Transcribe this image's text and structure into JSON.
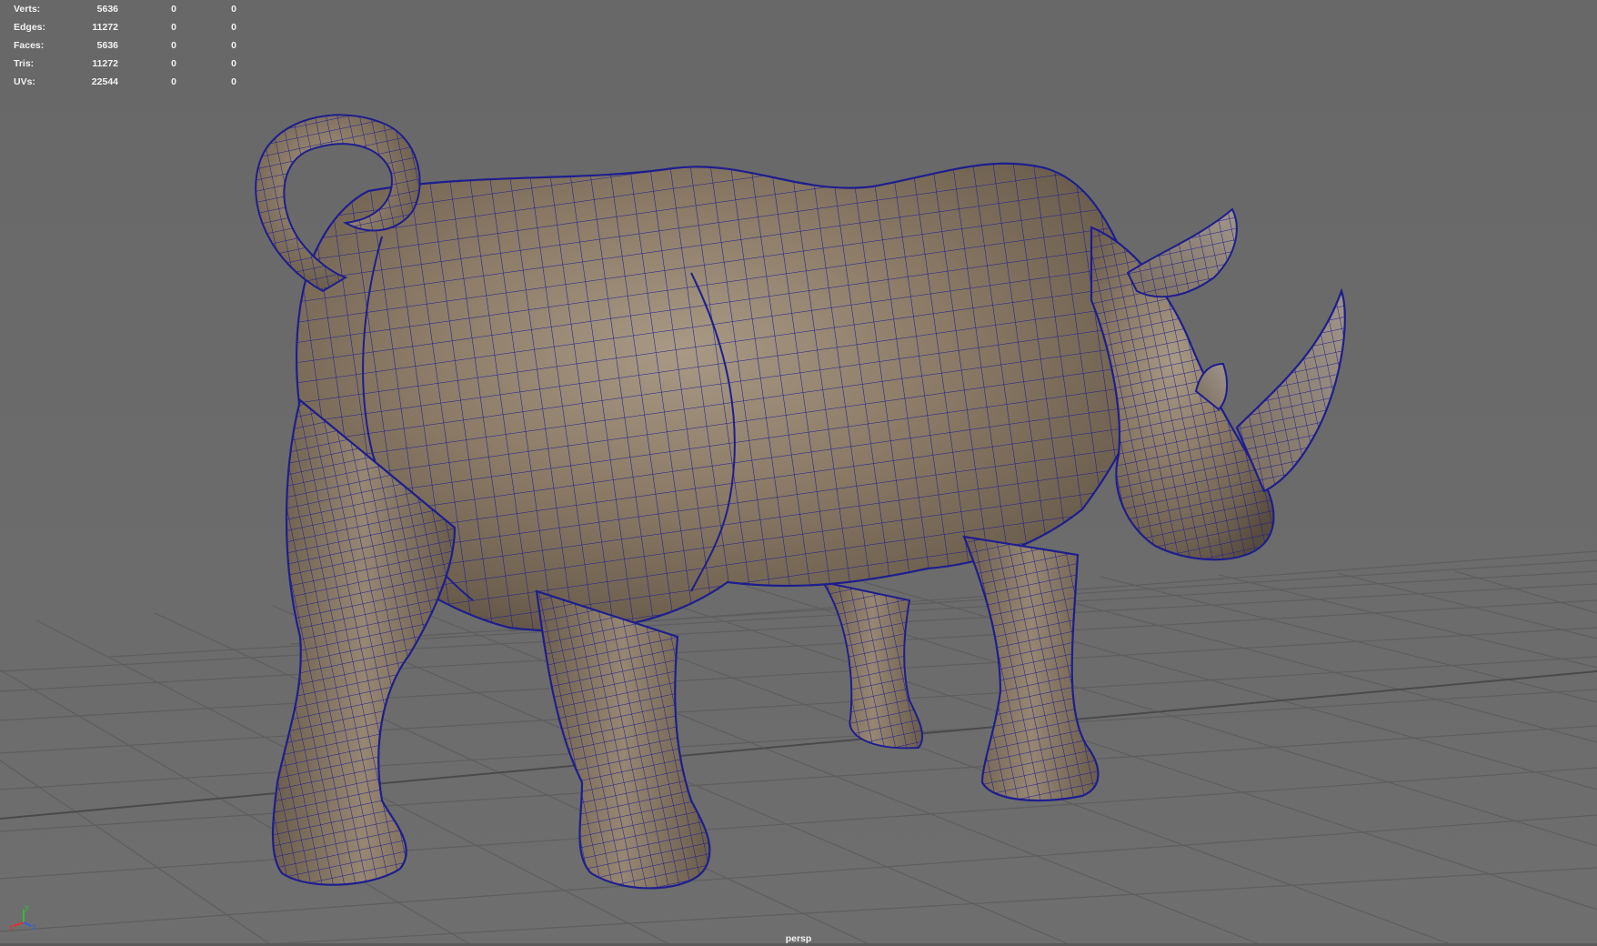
{
  "hud": {
    "stats": [
      {
        "label": "Verts:",
        "v1": "5636",
        "v2": "0",
        "v3": "0"
      },
      {
        "label": "Edges:",
        "v1": "11272",
        "v2": "0",
        "v3": "0"
      },
      {
        "label": "Faces:",
        "v1": "5636",
        "v2": "0",
        "v3": "0"
      },
      {
        "label": "Tris:",
        "v1": "11272",
        "v2": "0",
        "v3": "0"
      },
      {
        "label": "UVs:",
        "v1": "22544",
        "v2": "0",
        "v3": "0"
      }
    ]
  },
  "viewport": {
    "camera": "persp",
    "background_color": "#6b6b6b",
    "grid_color": "#5c5c5c",
    "wireframe_color": "#1c1c8c",
    "mesh_color": "#8c7b68"
  },
  "axis": {
    "x": "x",
    "y": "y",
    "z": "z"
  }
}
